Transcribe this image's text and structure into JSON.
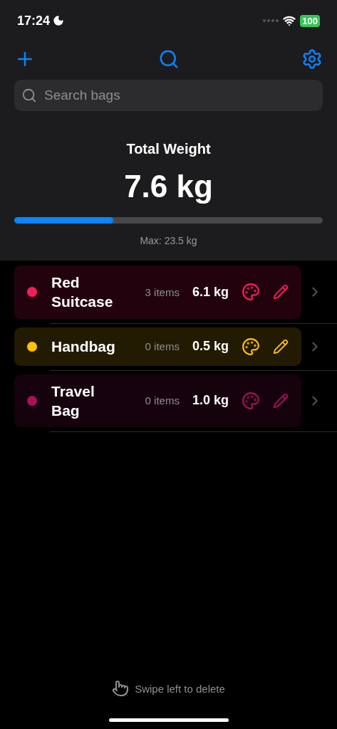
{
  "status_bar": {
    "time": "17:24",
    "battery": "100"
  },
  "search": {
    "placeholder": "Search bags"
  },
  "summary": {
    "title": "Total Weight",
    "value": "7.6 kg",
    "level": 0.32,
    "max": "Max: 23.5 kg"
  },
  "bags": [
    {
      "name": "Red Suitcase",
      "items": "3 items",
      "weight": "6.1 kg",
      "color": "#ff1a5e"
    },
    {
      "name": "Handbag",
      "items": "0 items",
      "weight": "0.5 kg",
      "color": "#ffc107"
    },
    {
      "name": "Travel Bag",
      "items": "0 items",
      "weight": "1.0 kg",
      "color": "#a8105c"
    }
  ],
  "footer": {
    "hint": "Swipe left to delete"
  }
}
